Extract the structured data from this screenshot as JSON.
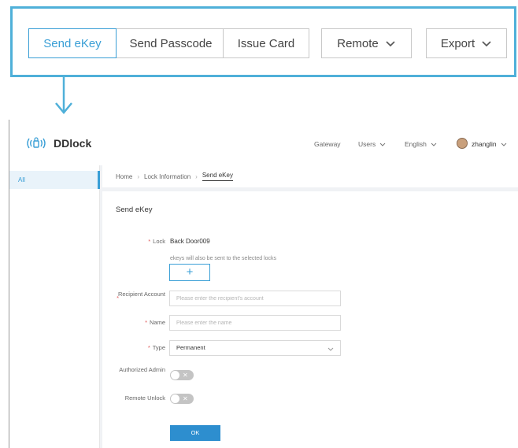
{
  "toolbar": {
    "buttons": [
      {
        "label": "Send eKey",
        "active": true
      },
      {
        "label": "Send Passcode",
        "active": false
      },
      {
        "label": "Issue Card",
        "active": false
      },
      {
        "label": "Remote",
        "active": false,
        "icon": "chevron-down-icon"
      },
      {
        "label": "Export",
        "active": false,
        "icon": "chevron-down-icon"
      }
    ]
  },
  "app": {
    "brand": "DDlock",
    "logo_icon": "wireless-lock-icon",
    "nav": {
      "gateway": "Gateway",
      "users": "Users",
      "language": "English",
      "username": "zhanglin"
    },
    "sidebar": {
      "items": [
        {
          "label": "All",
          "selected": true
        }
      ]
    },
    "breadcrumb": {
      "home": "Home",
      "lock_info": "Lock Information",
      "current": "Send eKey"
    },
    "form": {
      "title": "Send eKey",
      "lock_label": "Lock",
      "lock_value": "Back Door009",
      "lock_hint": "ekeys will also be sent to the selected locks",
      "add_label": "+",
      "recipient_label": "Recipient Account",
      "recipient_placeholder": "Please enter the recipient's account",
      "name_label": "Name",
      "name_placeholder": "Please enter the name",
      "type_label": "Type",
      "type_value": "Permanent",
      "admin_label": "Authorized Admin",
      "admin_on": false,
      "remote_label": "Remote Unlock",
      "remote_on": false,
      "ok_label": "OK"
    }
  },
  "colors": {
    "accent": "#3a9fd6",
    "frame": "#4fb0d9",
    "required": "#e05a5a",
    "ok_button": "#2d8ecf"
  }
}
